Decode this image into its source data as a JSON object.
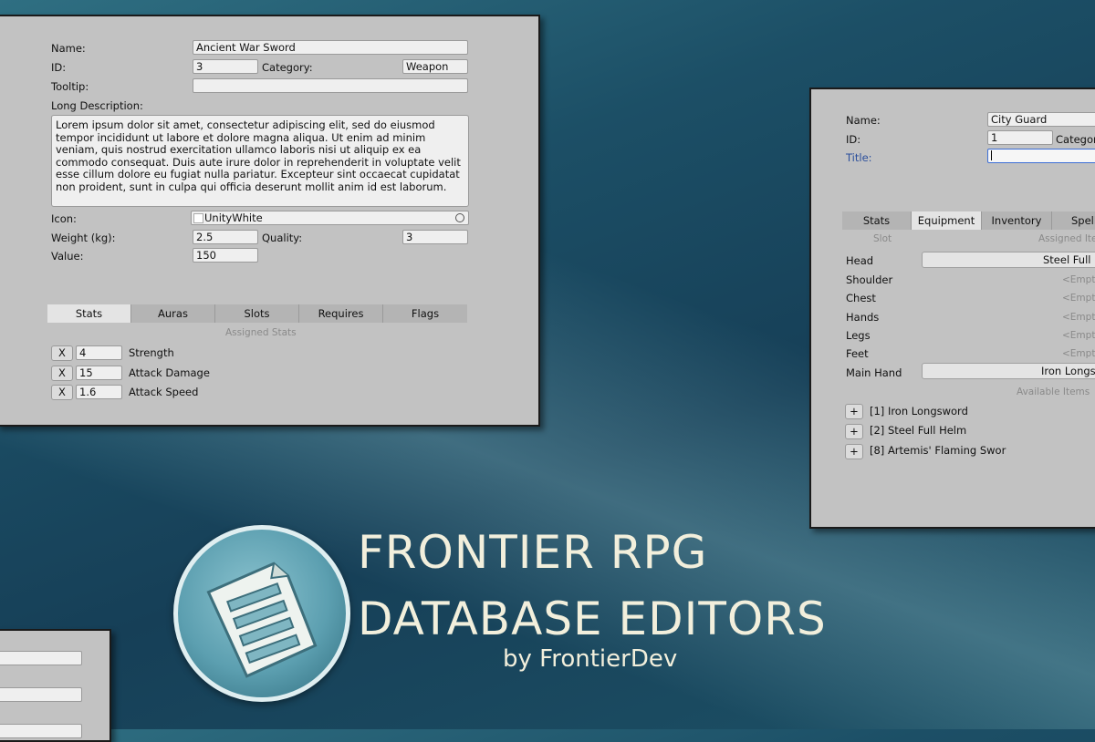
{
  "item_editor": {
    "name_label": "Name:",
    "name_value": "Ancient War Sword",
    "id_label": "ID:",
    "id_value": "3",
    "category_label": "Category:",
    "category_value": "Weapon",
    "tooltip_label": "Tooltip:",
    "tooltip_value": "",
    "long_desc_label": "Long Description:",
    "long_desc_value": "Lorem ipsum dolor sit amet, consectetur adipiscing elit, sed do eiusmod tempor incididunt ut labore et dolore magna aliqua. Ut enim ad minim veniam, quis nostrud exercitation ullamco laboris nisi ut aliquip ex ea commodo consequat. Duis aute irure dolor in reprehenderit in voluptate velit esse cillum dolore eu fugiat nulla pariatur. Excepteur sint occaecat cupidatat non proident, sunt in culpa qui officia deserunt mollit anim id est laborum.",
    "icon_label": "Icon:",
    "icon_value": "UnityWhite",
    "weight_label": "Weight (kg):",
    "weight_value": "2.5",
    "quality_label": "Quality:",
    "quality_value": "3",
    "value_label": "Value:",
    "value_value": "150",
    "tabs": [
      "Stats",
      "Auras",
      "Slots",
      "Requires",
      "Flags"
    ],
    "assigned_stats_label": "Assigned Stats",
    "remove_label": "X",
    "stats": [
      {
        "value": "4",
        "name": "Strength"
      },
      {
        "value": "15",
        "name": "Attack Damage"
      },
      {
        "value": "1.6",
        "name": "Attack Speed"
      }
    ]
  },
  "npc_editor": {
    "name_label": "Name:",
    "name_value": "City Guard",
    "id_label": "ID:",
    "id_value": "1",
    "category_label": "Categor",
    "title_label": "Title:",
    "tabs": [
      "Stats",
      "Equipment",
      "Inventory",
      "Spell"
    ],
    "slot_header": "Slot",
    "assigned_header": "Assigned Ite",
    "slots": [
      {
        "slot": "Head",
        "item": "Steel Full"
      },
      {
        "slot": "Shoulder",
        "item": "<Empty"
      },
      {
        "slot": "Chest",
        "item": "<Empty"
      },
      {
        "slot": "Hands",
        "item": "<Empty"
      },
      {
        "slot": "Legs",
        "item": "<Empty"
      },
      {
        "slot": "Feet",
        "item": "<Empty"
      },
      {
        "slot": "Main Hand",
        "item": "Iron Longs"
      }
    ],
    "available_header": "Available Items",
    "add_label": "+",
    "available": [
      "[1] Iron Longsword",
      "[2] Steel Full Helm",
      "[8] Artemis' Flaming Swor"
    ]
  },
  "branding": {
    "title_line1": "FRONTIER RPG",
    "title_line2": "DATABASE EDITORS",
    "byline": "by FrontierDev",
    "logo_icon": "document-icon",
    "title_color": "#f2efdc"
  }
}
